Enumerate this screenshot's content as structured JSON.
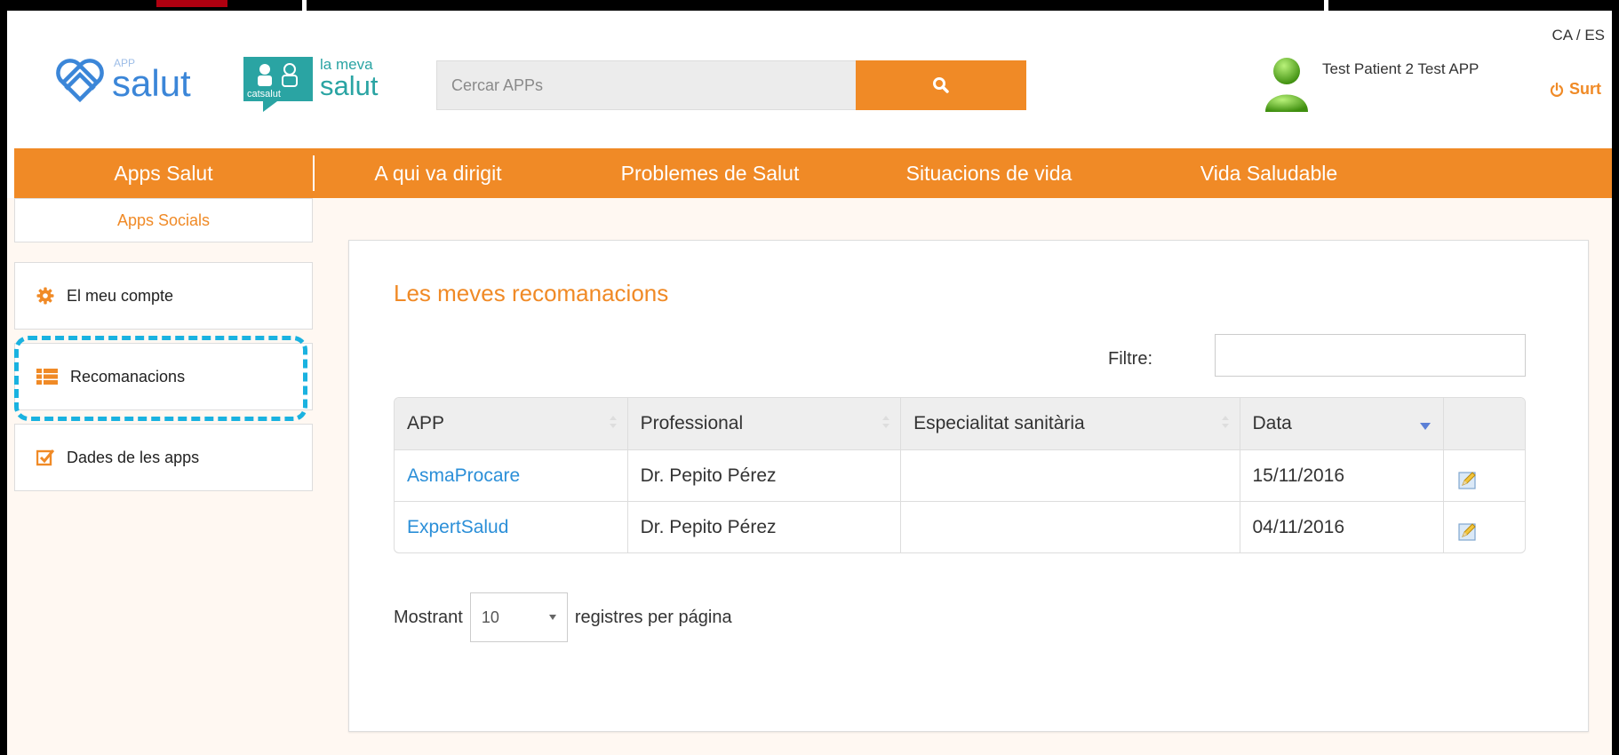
{
  "header": {
    "language": "CA / ES",
    "app_logo": {
      "superscript": "APP",
      "name": "salut"
    },
    "meva_logo": {
      "badge_text": "catsalut",
      "line1": "la meva",
      "line2": "salut"
    },
    "search": {
      "placeholder": "Cercar APPs",
      "button_icon": "search-icon"
    },
    "user": {
      "name": "Test Patient 2 Test APP"
    },
    "logout_label": "Surt"
  },
  "nav": {
    "items": [
      {
        "label": "Apps Salut"
      },
      {
        "label": "A qui va dirigit"
      },
      {
        "label": "Problemes de Salut"
      },
      {
        "label": "Situacions de vida"
      },
      {
        "label": "Vida Saludable"
      }
    ],
    "sub_item": "Apps Socials"
  },
  "sidebar": {
    "items": [
      {
        "label": "El meu compte",
        "icon": "gear-icon"
      },
      {
        "label": "Recomanacions",
        "icon": "list-icon"
      },
      {
        "label": "Dades de les apps",
        "icon": "checkbox-icon"
      }
    ]
  },
  "main": {
    "title": "Les meves recomanacions",
    "filter_label": "Filtre:",
    "filter_value": "",
    "table": {
      "columns": [
        "APP",
        "Professional",
        "Especialitat sanitària",
        "Data",
        ""
      ],
      "rows": [
        {
          "app": "AsmaProcare",
          "professional": "Dr. Pepito Pérez",
          "specialty": "",
          "date": "15/11/2016",
          "action_icon": "edit-icon"
        },
        {
          "app": "ExpertSalud",
          "professional": "Dr. Pepito Pérez",
          "specialty": "",
          "date": "04/11/2016",
          "action_icon": "edit-icon"
        }
      ]
    },
    "length": {
      "prefix": "Mostrant",
      "value": "10",
      "suffix": "registres per página"
    }
  },
  "colors": {
    "accent": "#f08a26",
    "link": "#2b8fd8",
    "highlight": "#1ab2e0"
  }
}
